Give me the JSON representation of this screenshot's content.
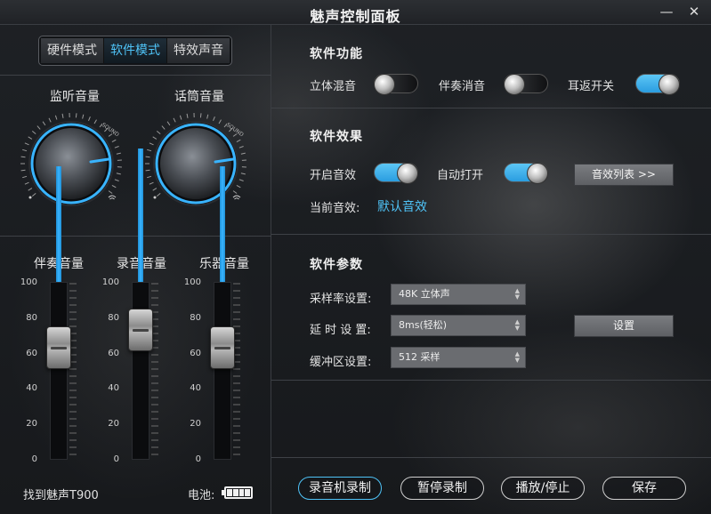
{
  "window": {
    "title": "魅声控制面板",
    "minimize_icon": "minimize-icon",
    "close_icon": "close-icon"
  },
  "modes": [
    {
      "label": "硬件模式",
      "active": false
    },
    {
      "label": "软件模式",
      "active": true
    },
    {
      "label": "特效声音",
      "active": false
    }
  ],
  "knobs": [
    {
      "label": "监听音量",
      "sound_text": "SOUND"
    },
    {
      "label": "话筒音量",
      "sound_text": "SOUND"
    }
  ],
  "faders": [
    {
      "label": "伴奏音量",
      "level_percent": 65
    },
    {
      "label": "录音音量",
      "level_percent": 75
    },
    {
      "label": "乐器音量",
      "level_percent": 65
    }
  ],
  "fader_scale": [
    "100",
    "80",
    "60",
    "40",
    "20",
    "0"
  ],
  "status": {
    "device": "找到魅声T900",
    "battery_label": "电池:",
    "battery_level_cells": 4
  },
  "software_functions": {
    "title": "软件功能",
    "items": [
      {
        "label": "立体混音",
        "state": "off"
      },
      {
        "label": "伴奏消音",
        "state": "off"
      },
      {
        "label": "耳返开关",
        "state": "on"
      }
    ]
  },
  "software_effects": {
    "title": "软件效果",
    "enable_label": "开启音效",
    "enable_state": "on",
    "auto_label": "自动打开",
    "auto_state": "on",
    "list_button": "音效列表 >>",
    "current_label": "当前音效:",
    "current_value": "默认音效"
  },
  "software_params": {
    "title": "软件参数",
    "sample_rate_label": "采样率设置:",
    "sample_rate_value": "48K 立体声",
    "delay_label": "延 时 设 置:",
    "delay_value": "8ms(轻松)",
    "buffer_label": "缓冲区设置:",
    "buffer_value": "512 采样",
    "settings_button": "设置"
  },
  "bottom_buttons": [
    {
      "label": "录音机录制",
      "active": true
    },
    {
      "label": "暂停录制",
      "active": false
    },
    {
      "label": "播放/停止",
      "active": false
    },
    {
      "label": "保存",
      "active": false
    }
  ],
  "colors": {
    "accent": "#4fc3f7",
    "fill": "#39b4ff"
  }
}
